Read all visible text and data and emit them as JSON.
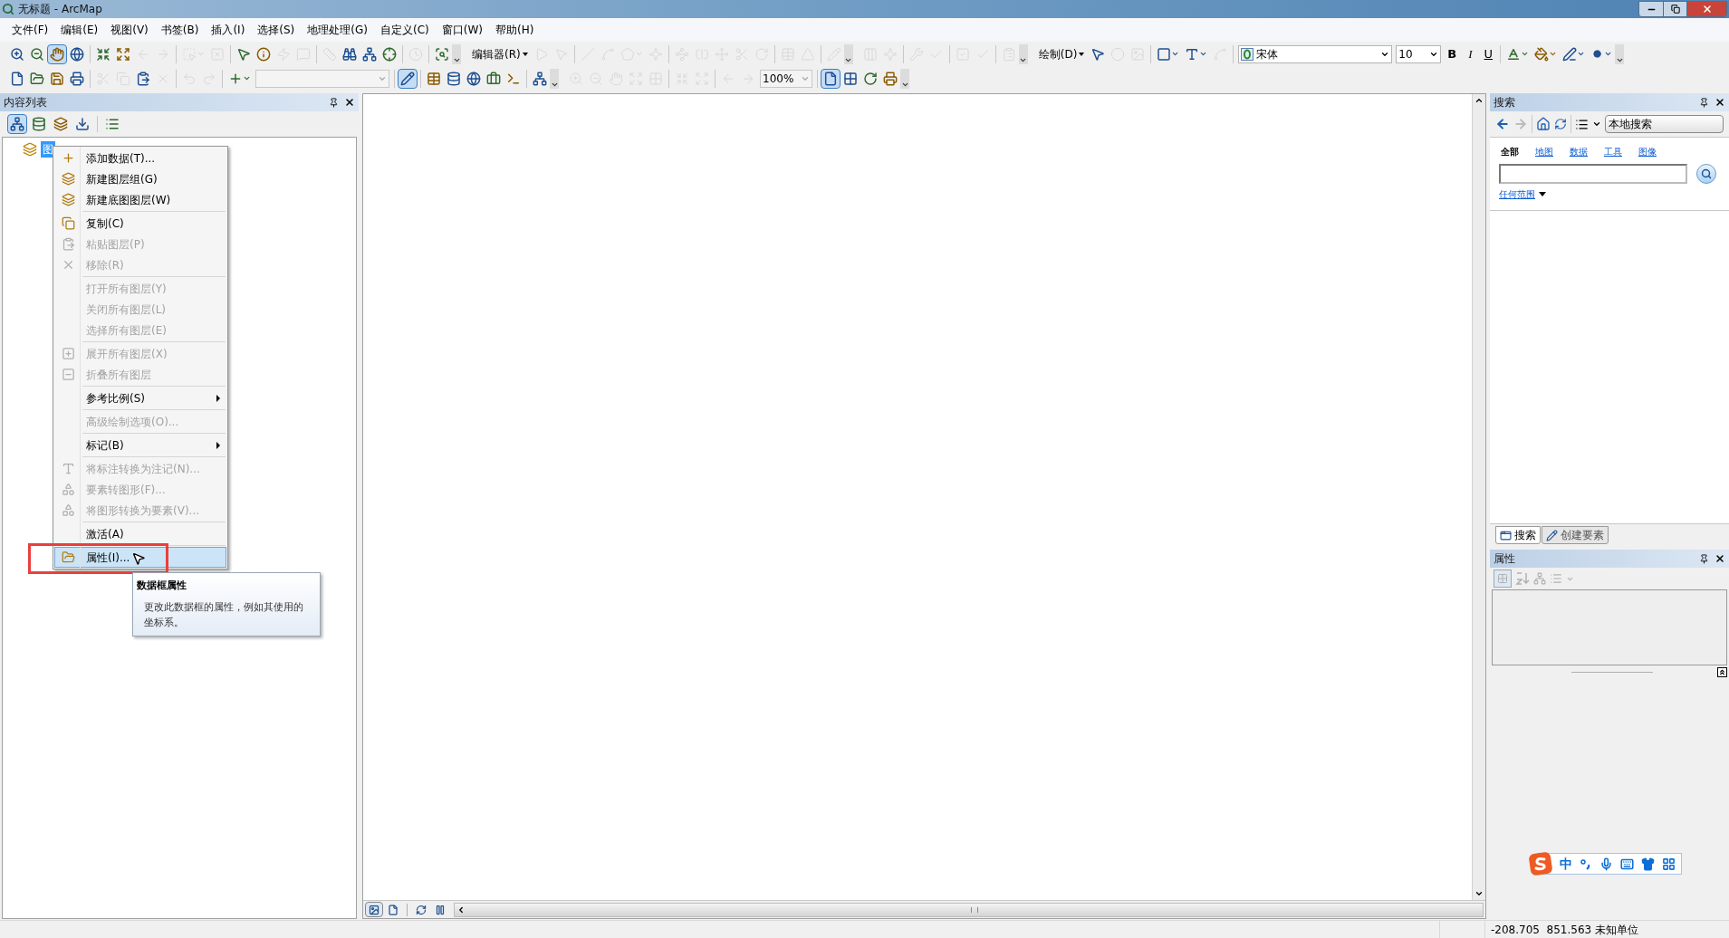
{
  "window": {
    "title": "无标题 - ArcMap"
  },
  "menu_bar": [
    "文件(F)",
    "编辑(E)",
    "视图(V)",
    "书签(B)",
    "插入(I)",
    "选择(S)",
    "地理处理(G)",
    "自定义(C)",
    "窗口(W)",
    "帮助(H)"
  ],
  "toolbars": [
    [
      {
        "kind": "tool",
        "pressed": false,
        "disabled": false
      },
      {
        "kind": "tool",
        "pressed": false,
        "disabled": false
      },
      {
        "kind": "tool",
        "pressed": true,
        "disabled": false
      },
      {
        "kind": "tool",
        "pressed": false,
        "disabled": false
      },
      {
        "kind": "sep"
      },
      {
        "kind": "tool",
        "pressed": false,
        "disabled": false
      },
      {
        "kind": "tool",
        "pressed": false,
        "disabled": false
      },
      {
        "kind": "tool",
        "pressed": false,
        "disabled": true
      },
      {
        "kind": "tool",
        "pressed": false,
        "disabled": true
      },
      {
        "kind": "sep"
      },
      {
        "kind": "split",
        "pressed": false,
        "disabled": true
      },
      {
        "kind": "tool",
        "pressed": false,
        "disabled": true
      },
      {
        "kind": "sep"
      },
      {
        "kind": "tool",
        "pressed": false,
        "disabled": false
      },
      {
        "kind": "tool",
        "pressed": false,
        "disabled": false
      },
      {
        "kind": "tool",
        "pressed": false,
        "disabled": true
      },
      {
        "kind": "tool",
        "pressed": false,
        "disabled": true
      },
      {
        "kind": "sep"
      },
      {
        "kind": "tool",
        "pressed": false,
        "disabled": true
      },
      {
        "kind": "tool",
        "pressed": false,
        "disabled": false
      },
      {
        "kind": "tool",
        "pressed": false,
        "disabled": false
      },
      {
        "kind": "tool",
        "pressed": false,
        "disabled": false
      },
      {
        "kind": "sep"
      },
      {
        "kind": "tool",
        "pressed": false,
        "disabled": true
      },
      {
        "kind": "sep"
      },
      {
        "kind": "tool",
        "pressed": false,
        "disabled": false
      },
      {
        "kind": "grip"
      },
      {
        "kind": "menu",
        "label": "编辑器(R)"
      },
      {
        "kind": "tool",
        "pressed": false,
        "disabled": true
      },
      {
        "kind": "tool",
        "pressed": false,
        "disabled": true
      },
      {
        "kind": "sep"
      },
      {
        "kind": "tool",
        "pressed": false,
        "disabled": true
      },
      {
        "kind": "tool",
        "pressed": false,
        "disabled": true
      },
      {
        "kind": "split",
        "pressed": false,
        "disabled": true
      },
      {
        "kind": "tool",
        "pressed": false,
        "disabled": true
      },
      {
        "kind": "sep"
      },
      {
        "kind": "tool",
        "pressed": false,
        "disabled": true
      },
      {
        "kind": "tool",
        "pressed": false,
        "disabled": true
      },
      {
        "kind": "tool",
        "pressed": false,
        "disabled": true
      },
      {
        "kind": "tool",
        "pressed": false,
        "disabled": true
      },
      {
        "kind": "tool",
        "pressed": false,
        "disabled": true
      },
      {
        "kind": "sep"
      },
      {
        "kind": "tool",
        "pressed": false,
        "disabled": true
      },
      {
        "kind": "tool",
        "pressed": false,
        "disabled": true
      },
      {
        "kind": "sep"
      },
      {
        "kind": "tool",
        "pressed": false,
        "disabled": true
      },
      {
        "kind": "grip"
      },
      {
        "kind": "tool",
        "pressed": false,
        "disabled": true
      },
      {
        "kind": "tool",
        "pressed": false,
        "disabled": true
      },
      {
        "kind": "sep"
      },
      {
        "kind": "tool",
        "pressed": false,
        "disabled": true
      },
      {
        "kind": "tool",
        "pressed": false,
        "disabled": true
      },
      {
        "kind": "sep"
      },
      {
        "kind": "tool",
        "pressed": false,
        "disabled": true
      },
      {
        "kind": "tool",
        "pressed": false,
        "disabled": true
      },
      {
        "kind": "sep"
      },
      {
        "kind": "tool",
        "pressed": false,
        "disabled": true
      },
      {
        "kind": "grip"
      },
      {
        "kind": "menu",
        "label": "绘制(D)"
      },
      {
        "kind": "tool",
        "pressed": false,
        "disabled": false
      },
      {
        "kind": "tool",
        "pressed": false,
        "disabled": true
      },
      {
        "kind": "tool",
        "pressed": false,
        "disabled": true
      },
      {
        "kind": "sep"
      },
      {
        "kind": "split",
        "pressed": false,
        "disabled": false
      },
      {
        "kind": "split",
        "pressed": false,
        "disabled": false
      },
      {
        "kind": "tool",
        "pressed": false,
        "disabled": true
      },
      {
        "kind": "sep"
      },
      {
        "kind": "fontbox",
        "value": "宋体"
      },
      {
        "kind": "sizebox",
        "value": "10"
      },
      {
        "kind": "text",
        "label": "B"
      },
      {
        "kind": "text",
        "label": "I"
      },
      {
        "kind": "text",
        "label": "U"
      },
      {
        "kind": "sep"
      },
      {
        "kind": "split",
        "pressed": false,
        "disabled": false
      },
      {
        "kind": "split",
        "pressed": false,
        "disabled": false
      },
      {
        "kind": "split",
        "pressed": false,
        "disabled": false
      },
      {
        "kind": "split",
        "pressed": false,
        "disabled": false
      },
      {
        "kind": "grip"
      }
    ],
    [
      {
        "kind": "tool",
        "pressed": false,
        "disabled": false
      },
      {
        "kind": "tool",
        "pressed": false,
        "disabled": false
      },
      {
        "kind": "tool",
        "pressed": false,
        "disabled": false
      },
      {
        "kind": "tool",
        "pressed": false,
        "disabled": false
      },
      {
        "kind": "sep"
      },
      {
        "kind": "tool",
        "pressed": false,
        "disabled": true
      },
      {
        "kind": "tool",
        "pressed": false,
        "disabled": true
      },
      {
        "kind": "tool",
        "pressed": false,
        "disabled": false
      },
      {
        "kind": "tool",
        "pressed": false,
        "disabled": true
      },
      {
        "kind": "sep"
      },
      {
        "kind": "tool",
        "pressed": false,
        "disabled": true
      },
      {
        "kind": "tool",
        "pressed": false,
        "disabled": true
      },
      {
        "kind": "sep"
      },
      {
        "kind": "split",
        "pressed": false,
        "disabled": false
      },
      {
        "kind": "scalebox"
      },
      {
        "kind": "sep"
      },
      {
        "kind": "tool",
        "pressed": true,
        "disabled": false
      },
      {
        "kind": "sep"
      },
      {
        "kind": "tool",
        "pressed": false,
        "disabled": false
      },
      {
        "kind": "tool",
        "pressed": false,
        "disabled": false
      },
      {
        "kind": "tool",
        "pressed": false,
        "disabled": false
      },
      {
        "kind": "tool",
        "pressed": false,
        "disabled": false
      },
      {
        "kind": "tool",
        "pressed": false,
        "disabled": false
      },
      {
        "kind": "sep"
      },
      {
        "kind": "tool",
        "pressed": false,
        "disabled": false
      },
      {
        "kind": "grip"
      },
      {
        "kind": "tool",
        "pressed": false,
        "disabled": true
      },
      {
        "kind": "tool",
        "pressed": false,
        "disabled": true
      },
      {
        "kind": "tool",
        "pressed": false,
        "disabled": true
      },
      {
        "kind": "tool",
        "pressed": false,
        "disabled": true
      },
      {
        "kind": "tool",
        "pressed": false,
        "disabled": true
      },
      {
        "kind": "sep"
      },
      {
        "kind": "tool",
        "pressed": false,
        "disabled": true
      },
      {
        "kind": "tool",
        "pressed": false,
        "disabled": true
      },
      {
        "kind": "sep"
      },
      {
        "kind": "tool",
        "pressed": false,
        "disabled": true
      },
      {
        "kind": "tool",
        "pressed": false,
        "disabled": true
      },
      {
        "kind": "zoombox",
        "value": "100%"
      },
      {
        "kind": "sep"
      },
      {
        "kind": "tool",
        "pressed": true,
        "disabled": false
      },
      {
        "kind": "tool",
        "pressed": false,
        "disabled": false
      },
      {
        "kind": "tool",
        "pressed": false,
        "disabled": false
      },
      {
        "kind": "tool",
        "pressed": false,
        "disabled": false
      },
      {
        "kind": "grip"
      }
    ]
  ],
  "table_of_contents": {
    "title": "内容列表",
    "tools": [
      {
        "kind": "tool",
        "pressed": true
      },
      {
        "kind": "tool",
        "pressed": false
      },
      {
        "kind": "tool",
        "pressed": false
      },
      {
        "kind": "tool",
        "pressed": false
      },
      {
        "kind": "sep"
      },
      {
        "kind": "tool",
        "pressed": false
      }
    ],
    "layers": [
      {
        "label": "图",
        "selected": true
      }
    ]
  },
  "context_menu": {
    "items": [
      {
        "kind": "item",
        "label": "添加数据(T)...",
        "disabled": false,
        "selected": false
      },
      {
        "kind": "item",
        "label": "新建图层组(G)",
        "disabled": false,
        "selected": false
      },
      {
        "kind": "item",
        "label": "新建底图图层(W)",
        "disabled": false,
        "selected": false
      },
      {
        "kind": "separator"
      },
      {
        "kind": "item",
        "label": "复制(C)",
        "disabled": false,
        "selected": false
      },
      {
        "kind": "item",
        "label": "粘贴图层(P)",
        "disabled": true,
        "selected": false
      },
      {
        "kind": "item",
        "label": "移除(R)",
        "disabled": true,
        "selected": false
      },
      {
        "kind": "separator"
      },
      {
        "kind": "item",
        "label": "打开所有图层(Y)",
        "disabled": true,
        "selected": false
      },
      {
        "kind": "item",
        "label": "关闭所有图层(L)",
        "disabled": true,
        "selected": false
      },
      {
        "kind": "item",
        "label": "选择所有图层(E)",
        "disabled": true,
        "selected": false
      },
      {
        "kind": "separator"
      },
      {
        "kind": "item",
        "label": "展开所有图层(X)",
        "disabled": true,
        "selected": false
      },
      {
        "kind": "item",
        "label": "折叠所有图层",
        "disabled": true,
        "selected": false
      },
      {
        "kind": "separator"
      },
      {
        "kind": "submenu",
        "label": "参考比例(S)",
        "disabled": false,
        "selected": false
      },
      {
        "kind": "separator"
      },
      {
        "kind": "item",
        "label": "高级绘制选项(O)...",
        "disabled": true,
        "selected": false
      },
      {
        "kind": "separator"
      },
      {
        "kind": "submenu",
        "label": "标记(B)",
        "disabled": false,
        "selected": false
      },
      {
        "kind": "separator"
      },
      {
        "kind": "item",
        "label": "将标注转换为注记(N)...",
        "disabled": true,
        "selected": false
      },
      {
        "kind": "item",
        "label": "要素转图形(F)...",
        "disabled": true,
        "selected": false
      },
      {
        "kind": "item",
        "label": "将图形转换为要素(V)...",
        "disabled": true,
        "selected": false
      },
      {
        "kind": "separator"
      },
      {
        "kind": "item",
        "label": "激活(A)",
        "disabled": false,
        "selected": false
      },
      {
        "kind": "separator"
      },
      {
        "kind": "item",
        "label": "属性(I)...",
        "disabled": false,
        "selected": true
      }
    ]
  },
  "tooltip": {
    "title": "数据框属性",
    "text": "更改此数据框的属性，例如其使用的坐标系。"
  },
  "map_view": {
    "view_buttons": [
      {
        "kind": "tool",
        "pressed": true
      },
      {
        "kind": "tool",
        "pressed": false
      },
      {
        "kind": "sep"
      },
      {
        "kind": "tool",
        "pressed": false
      },
      {
        "kind": "tool",
        "pressed": false
      }
    ]
  },
  "search_panel": {
    "title": "搜索",
    "scope": "本地搜索",
    "filters": [
      {
        "label": "全部",
        "selected": true
      },
      {
        "label": "地图",
        "selected": false
      },
      {
        "label": "数据",
        "selected": false
      },
      {
        "label": "工具",
        "selected": false
      },
      {
        "label": "图像",
        "selected": false
      }
    ],
    "extent": "任何范围"
  },
  "dock_tabs": [
    {
      "label": "搜索",
      "selected": true
    },
    {
      "label": "创建要素",
      "selected": false
    }
  ],
  "properties_panel": {
    "title": "属性"
  },
  "ime_bar": {
    "label": "中"
  },
  "status_bar": {
    "coordinates": "-208.705  851.563 未知单位"
  }
}
